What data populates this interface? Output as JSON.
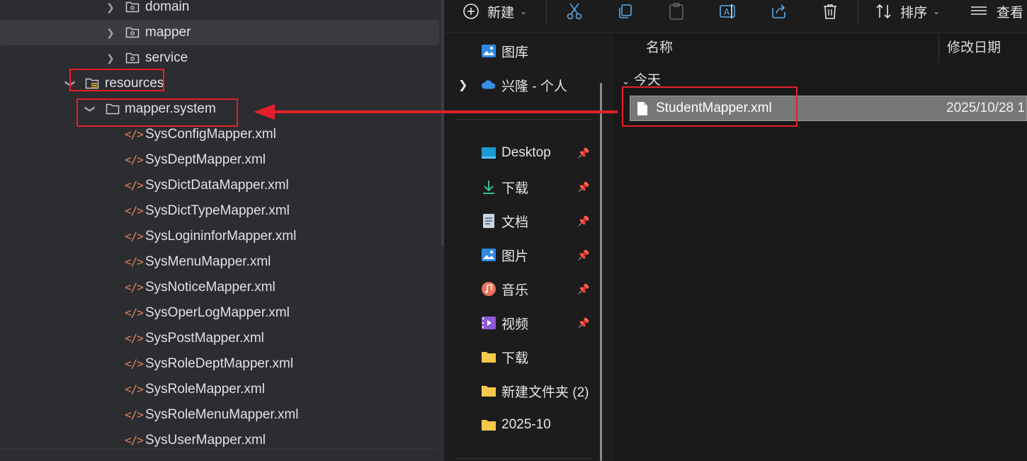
{
  "ide_tree": {
    "items": [
      {
        "label": "domain",
        "kind": "folder",
        "expanded": false
      },
      {
        "label": "mapper",
        "kind": "folder",
        "expanded": false,
        "selected": true
      },
      {
        "label": "service",
        "kind": "folder",
        "expanded": false
      },
      {
        "label": "resources",
        "kind": "resources-folder",
        "expanded": true
      },
      {
        "label": "mapper.system",
        "kind": "folder",
        "expanded": true
      },
      {
        "label": "SysConfigMapper.xml",
        "kind": "xml"
      },
      {
        "label": "SysDeptMapper.xml",
        "kind": "xml"
      },
      {
        "label": "SysDictDataMapper.xml",
        "kind": "xml"
      },
      {
        "label": "SysDictTypeMapper.xml",
        "kind": "xml"
      },
      {
        "label": "SysLogininforMapper.xml",
        "kind": "xml"
      },
      {
        "label": "SysMenuMapper.xml",
        "kind": "xml"
      },
      {
        "label": "SysNoticeMapper.xml",
        "kind": "xml"
      },
      {
        "label": "SysOperLogMapper.xml",
        "kind": "xml"
      },
      {
        "label": "SysPostMapper.xml",
        "kind": "xml"
      },
      {
        "label": "SysRoleDeptMapper.xml",
        "kind": "xml"
      },
      {
        "label": "SysRoleMapper.xml",
        "kind": "xml"
      },
      {
        "label": "SysRoleMenuMapper.xml",
        "kind": "xml"
      },
      {
        "label": "SysUserMapper.xml",
        "kind": "xml"
      }
    ]
  },
  "explorer": {
    "toolbar": {
      "new_label": "新建",
      "sort_label": "排序",
      "view_label": "查看"
    },
    "nav": {
      "items": [
        {
          "label": "图库",
          "icon": "gallery-icon"
        },
        {
          "label": "兴隆 - 个人",
          "icon": "onedrive-icon"
        },
        {
          "label": "Desktop",
          "icon": "desktop-icon"
        },
        {
          "label": "下载",
          "icon": "download-icon"
        },
        {
          "label": "文档",
          "icon": "documents-icon"
        },
        {
          "label": "图片",
          "icon": "pictures-icon"
        },
        {
          "label": "音乐",
          "icon": "music-icon"
        },
        {
          "label": "视频",
          "icon": "videos-icon"
        },
        {
          "label": "下载",
          "icon": "folder-icon"
        },
        {
          "label": "新建文件夹 (2)",
          "icon": "folder-icon"
        },
        {
          "label": "2025-10",
          "icon": "folder-icon"
        }
      ]
    },
    "columns": {
      "name": "名称",
      "date": "修改日期"
    },
    "group_label": "今天",
    "file": {
      "name": "StudentMapper.xml",
      "date": "2025/10/28 1"
    }
  },
  "colors": {
    "annotation_red": "#e3202a",
    "xml_icon_orange": "#e0845f",
    "folder_yellow": "#f7c94b"
  }
}
